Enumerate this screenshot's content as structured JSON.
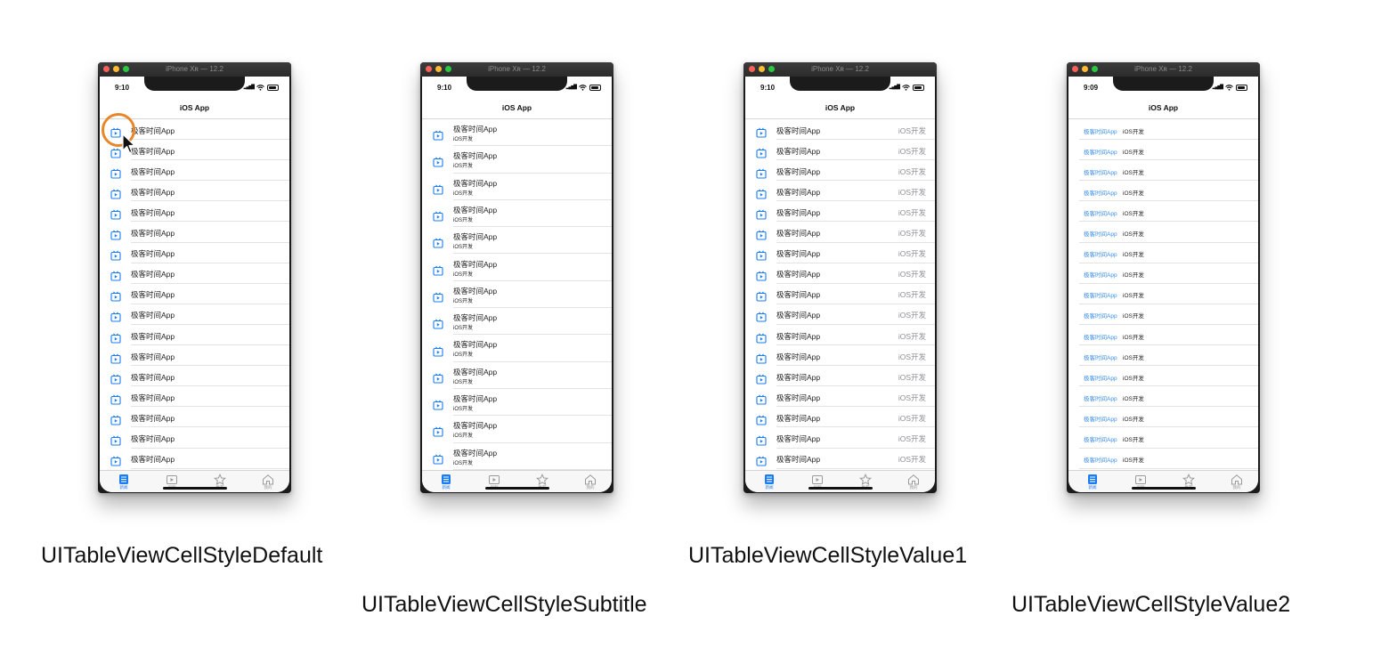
{
  "window_title": "iPhone Xʀ — 12.2",
  "nav_title": "iOS App",
  "cell_title": "极客时间App",
  "cell_subtitle": "iOS开发",
  "cell_detail": "iOS开发",
  "tabs": [
    {
      "label": "新闻",
      "icon": "list-icon"
    },
    {
      "label": "视频",
      "icon": "video-icon"
    },
    {
      "label": "推荐",
      "icon": "star-icon"
    },
    {
      "label": "我的",
      "icon": "home-icon"
    }
  ],
  "accent_color": "#1a7cf5",
  "simulators": [
    {
      "style": "default",
      "time": "9:10",
      "caption": "UITableViewCellStyleDefault"
    },
    {
      "style": "subtitle",
      "time": "9:10",
      "caption": "UITableViewCellStyleSubtitle"
    },
    {
      "style": "value1",
      "time": "9:10",
      "caption": "UITableViewCellStyleValue1"
    },
    {
      "style": "value2",
      "time": "9:09",
      "caption": "UITableViewCellStyleValue2"
    }
  ]
}
